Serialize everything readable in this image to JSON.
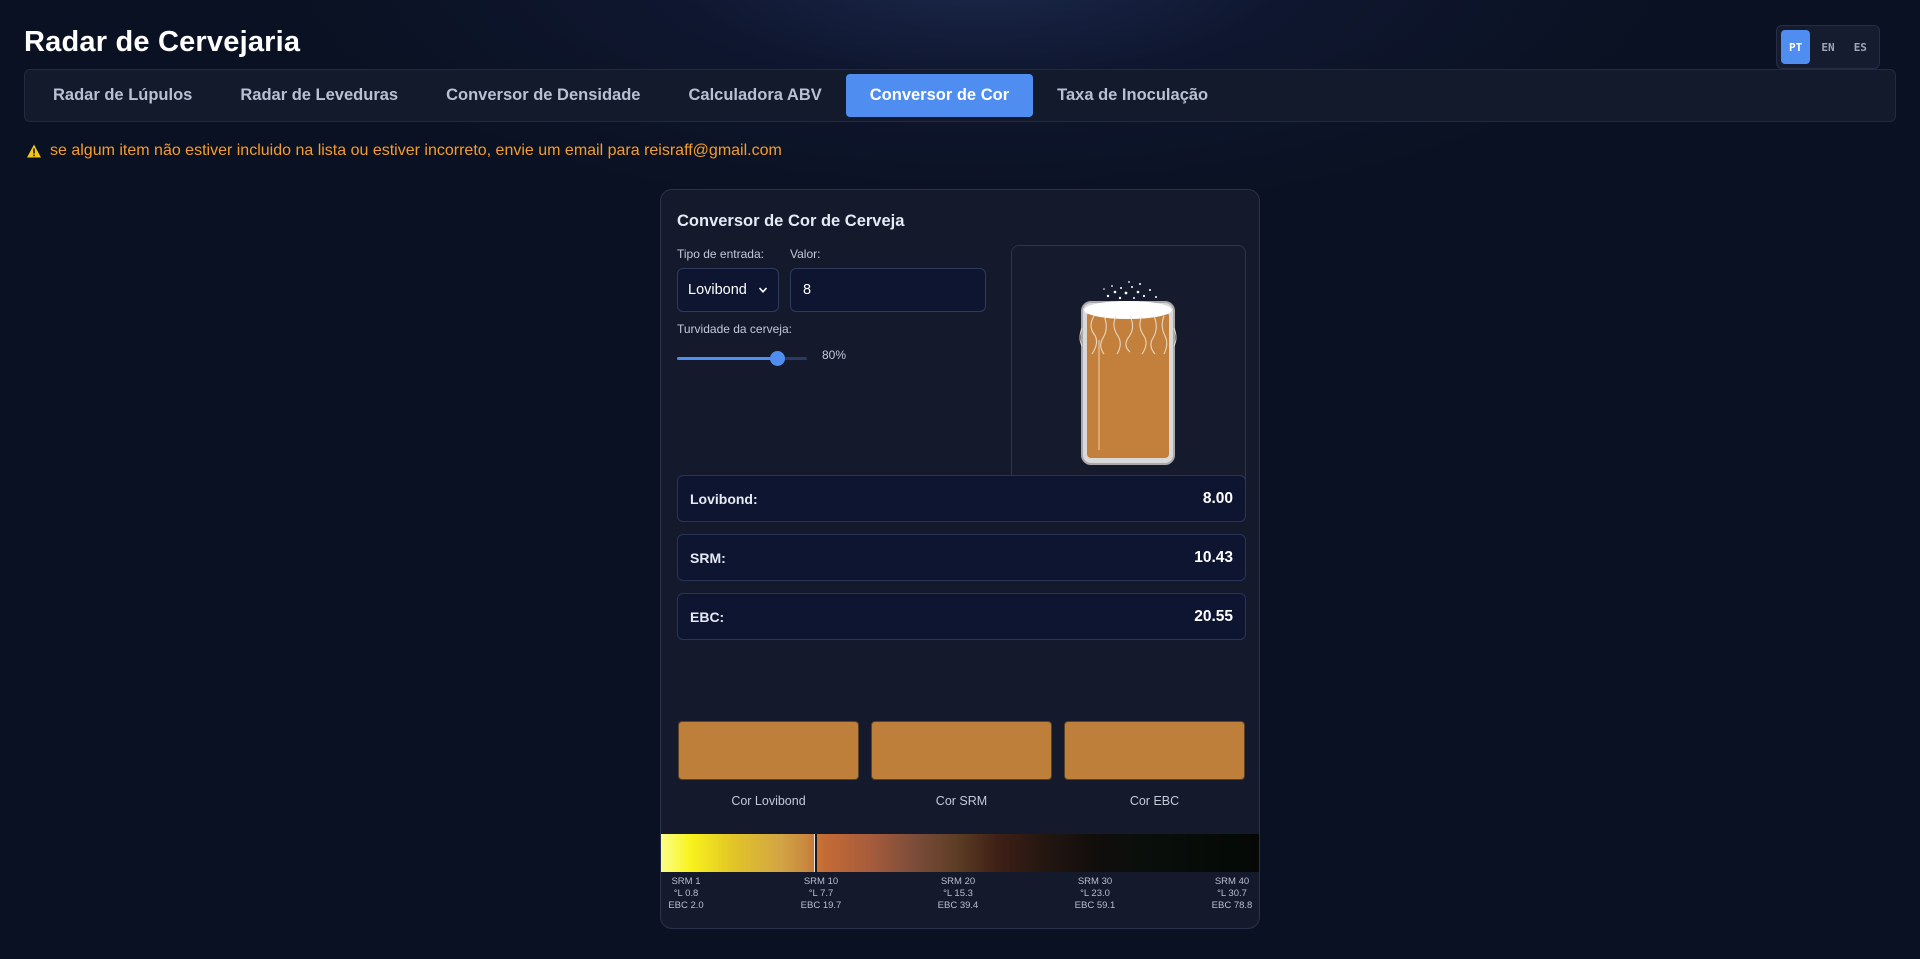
{
  "app": {
    "title": "Radar de Cervejaria"
  },
  "languages": [
    {
      "code": "PT",
      "active": true
    },
    {
      "code": "EN",
      "active": false
    },
    {
      "code": "ES",
      "active": false
    }
  ],
  "tabs": [
    {
      "label": "Radar de Lúpulos",
      "active": false
    },
    {
      "label": "Radar de Leveduras",
      "active": false
    },
    {
      "label": "Conversor de Densidade",
      "active": false
    },
    {
      "label": "Calculadora ABV",
      "active": false
    },
    {
      "label": "Conversor de Cor",
      "active": true
    },
    {
      "label": "Taxa de Inoculação",
      "active": false
    }
  ],
  "notice": {
    "icon": "warning-icon",
    "text": "se algum item não estiver incluido na lista ou estiver incorreto, envie um email para reisraff@gmail.com"
  },
  "converter": {
    "title": "Conversor de Cor de Cerveja",
    "input_type_label": "Tipo de entrada:",
    "input_type_value": "Lovibond",
    "value_label": "Valor:",
    "value": "8",
    "turbidity_label": "Turvidade da cerveja:",
    "turbidity_percent": 80,
    "turbidity_text": "80%",
    "results": [
      {
        "label": "Lovibond:",
        "value": "8.00"
      },
      {
        "label": "SRM:",
        "value": "10.43"
      },
      {
        "label": "EBC:",
        "value": "20.55"
      }
    ],
    "swatches": [
      {
        "label": "Cor Lovibond",
        "color": "#be7f3a"
      },
      {
        "label": "Cor SRM",
        "color": "#be7f3a"
      },
      {
        "label": "Cor EBC",
        "color": "#be7f3a"
      }
    ],
    "beer_color": "#c2803c",
    "scale_marker_srm": 10.43,
    "scale_ticks": [
      {
        "srm": "SRM 1",
        "l": "°L 0.8",
        "ebc": "EBC 2.0"
      },
      {
        "srm": "SRM 10",
        "l": "°L 7.7",
        "ebc": "EBC 19.7"
      },
      {
        "srm": "SRM 20",
        "l": "°L 15.3",
        "ebc": "EBC 39.4"
      },
      {
        "srm": "SRM 30",
        "l": "°L 23.0",
        "ebc": "EBC 59.1"
      },
      {
        "srm": "SRM 40",
        "l": "°L 30.7",
        "ebc": "EBC 78.8"
      }
    ]
  }
}
